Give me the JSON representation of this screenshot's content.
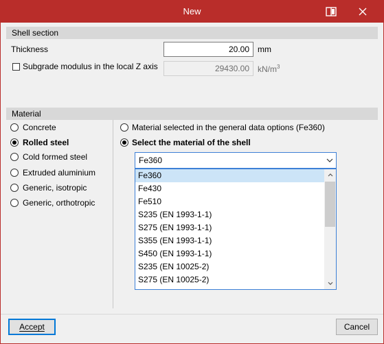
{
  "window": {
    "title": "New"
  },
  "shell_section": {
    "header": "Shell section",
    "thickness_label": "Thickness",
    "thickness_value": "20.00",
    "thickness_unit": "mm",
    "subgrade_label": "Subgrade modulus in the local Z axis",
    "subgrade_checked": false,
    "subgrade_value": "29430.00",
    "subgrade_unit": "kN/m",
    "subgrade_unit_exp": "3"
  },
  "material": {
    "header": "Material",
    "types": [
      {
        "label": "Concrete",
        "selected": false
      },
      {
        "label": "Rolled steel",
        "selected": true
      },
      {
        "label": "Cold formed steel",
        "selected": false
      },
      {
        "label": "Extruded aluminium",
        "selected": false
      },
      {
        "label": "Generic, isotropic",
        "selected": false
      },
      {
        "label": "Generic, orthotropic",
        "selected": false
      }
    ],
    "option_general": "Material selected in the general data options (Fe360)",
    "option_shell": "Select the material of the shell",
    "selected_material": "Fe360",
    "dropdown_items": [
      "Fe360",
      "Fe430",
      "Fe510",
      "S235 (EN 1993-1-1)",
      "S275 (EN 1993-1-1)",
      "S355 (EN 1993-1-1)",
      "S450 (EN 1993-1-1)",
      "S235 (EN 10025-2)",
      "S275 (EN 10025-2)"
    ]
  },
  "buttons": {
    "accept": "Accept",
    "cancel": "Cancel"
  },
  "colors": {
    "titlebar": "#b92d2a",
    "focus_border": "#3c7fd6",
    "selection": "#cce4f7"
  }
}
